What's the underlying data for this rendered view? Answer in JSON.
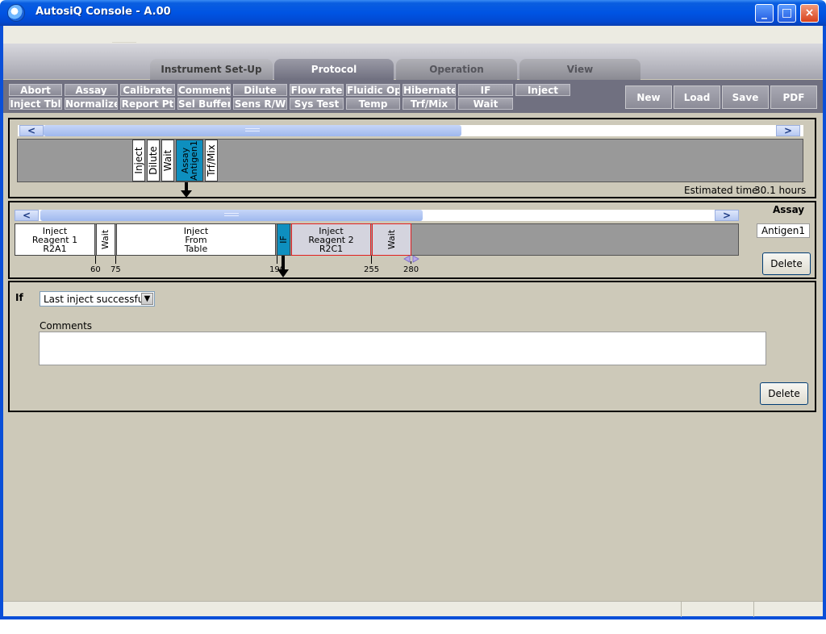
{
  "window": {
    "title": "AutosiQ Console - A.00",
    "controls": [
      "_",
      "□",
      "×"
    ]
  },
  "tabs": [
    {
      "label": "Instrument Set-Up",
      "state": "off"
    },
    {
      "label": "Protocol",
      "state": "active"
    },
    {
      "label": "Operation",
      "state": "dim"
    },
    {
      "label": "View",
      "state": "dim"
    }
  ],
  "commands": {
    "row1": [
      "Abort",
      "Assay",
      "Calibrate",
      "Comment",
      "Dilute",
      "Flow rate",
      "Fluidic Op",
      "Hibernate",
      "IF",
      "Inject"
    ],
    "row2": [
      "Inject Tbl",
      "Normalize",
      "Report Pt",
      "Sel Buffer",
      "Sens R/W",
      "Sys Test",
      "Temp",
      "Trf/Mix",
      "Wait"
    ]
  },
  "file_buttons": {
    "new": "New",
    "load": "Load",
    "save": "Save",
    "pdf": "PDF"
  },
  "scroll": {
    "left": "<",
    "right": ">"
  },
  "protocol_panel": {
    "steps": [
      {
        "label": "Inject",
        "selected": false
      },
      {
        "label": "Dilute",
        "selected": false
      },
      {
        "label": "Wait",
        "selected": false
      },
      {
        "label": "Assay\nAntigen1",
        "selected": true
      },
      {
        "label": "Trf/Mix",
        "selected": false
      }
    ],
    "estimated_label": "Estimated time",
    "estimated_value": "30.1 hours"
  },
  "assay_panel": {
    "heading": "Assay",
    "name_value": "Antigen1",
    "delete_label": "Delete",
    "steps": [
      {
        "label": "Inject\nReagent 1\nR2A1"
      },
      {
        "label": "Wait",
        "vertical": true
      },
      {
        "label": "Inject\nFrom\nTable"
      },
      {
        "label": "IF",
        "vertical": true,
        "highlight": true
      },
      {
        "label": "Inject\nReagent 2\nR2C1",
        "selected": true
      },
      {
        "label": "Wait",
        "vertical": true,
        "selected": true
      }
    ],
    "ticks": [
      "60",
      "75",
      "190",
      "255",
      "280"
    ]
  },
  "if_panel": {
    "label": "If",
    "condition": "Last inject successful",
    "comments_label": "Comments",
    "comments_value": "",
    "delete_label": "Delete"
  },
  "colors": {
    "accent": "#0e8fbf",
    "titlebar": "#0054e3",
    "panel": "#cdc9b9"
  }
}
